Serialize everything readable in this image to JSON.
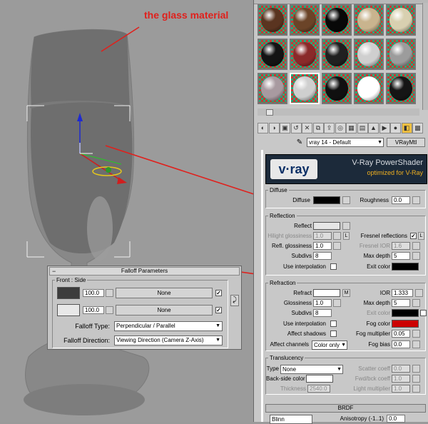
{
  "annotation": {
    "text": "the glass material",
    "color": "#e0201c"
  },
  "material_editor": {
    "slots": [
      {
        "icon": "brown-sphere-icon",
        "color": "#5a3420"
      },
      {
        "icon": "brown-sphere-icon",
        "color": "#6b4428"
      },
      {
        "icon": "black-sphere-icon",
        "color": "#080808"
      },
      {
        "icon": "beige-sphere-icon",
        "color": "#c9b48e"
      },
      {
        "icon": "cream-sphere-icon",
        "color": "#d8d0b0"
      },
      {
        "icon": "glossy-black-sphere-icon",
        "color": "#141414"
      },
      {
        "icon": "checker-sphere-icon",
        "color": "#8a2a2a"
      },
      {
        "icon": "dark-sphere-icon",
        "color": "#202020"
      },
      {
        "icon": "pearl-sphere-icon",
        "color": "#cfcfcf"
      },
      {
        "icon": "gray-sphere-icon",
        "color": "#9c9c9c"
      },
      {
        "icon": "striped-sphere-icon",
        "color": "#a89aa0"
      },
      {
        "icon": "noise-sphere-icon",
        "color": "#cfcfcf"
      },
      {
        "icon": "dark-sphere-icon",
        "color": "#101010"
      },
      {
        "icon": "white-sphere-icon",
        "color": "#ffffff"
      },
      {
        "icon": "dark-sphere-icon",
        "color": "#151515"
      }
    ],
    "toolbar_icons": [
      "get-material-icon",
      "put-material-icon",
      "assign-material-icon",
      "reset-icon",
      "delete-icon",
      "make-unique-icon",
      "put-library-icon",
      "effects-icon",
      "show-map-icon",
      "show-end-icon",
      "go-parent-icon",
      "go-sibling-icon",
      "sample-type-icon",
      "backlight-icon",
      "background-icon"
    ],
    "material_name": "vray 14 - Default",
    "material_type": "VRayMtl",
    "banner": {
      "logo": "v·ray",
      "title": "V-Ray PowerShader",
      "subtitle": "optimized for V-Ray"
    },
    "diffuse": {
      "group": "Diffuse",
      "diffuse_label": "Diffuse",
      "diffuse_color": "#000000",
      "roughness_label": "Roughness",
      "roughness": "0.0"
    },
    "reflection": {
      "group": "Reflection",
      "reflect_label": "Reflect",
      "reflect_color": "#e6e6e6",
      "hilight_label": "Hilight glossiness",
      "hilight": "1.0",
      "l1": "L",
      "fresnel_label": "Fresnel reflections",
      "fresnel_checked": "✓",
      "l2": "L",
      "refl_gloss_label": "Refl. glossiness",
      "refl_gloss": "1.0",
      "fresnel_ior_label": "Fresnel IOR",
      "fresnel_ior": "1.6",
      "subdivs_label": "Subdivs",
      "subdivs": "8",
      "max_depth_label": "Max depth",
      "max_depth": "5",
      "use_interp_label": "Use interpolation",
      "exit_label": "Exit color",
      "exit_color": "#000000"
    },
    "refraction": {
      "group": "Refraction",
      "refract_label": "Refract",
      "refract_color": "#ffffff",
      "map_label": "M",
      "ior_label": "IOR",
      "ior": "1.333",
      "gloss_label": "Glossiness",
      "gloss": "1.0",
      "max_depth_label": "Max depth",
      "max_depth": "5",
      "subdivs_label": "Subdivs",
      "subdivs": "8",
      "exit_label": "Exit color",
      "exit_color": "#000000",
      "use_interp_label": "Use interpolation",
      "fog_color_label": "Fog color",
      "fog_color": "#cc0000",
      "affect_shadows_label": "Affect shadows",
      "fog_mult_label": "Fog multiplier",
      "fog_mult": "0.05",
      "affect_channels_label": "Affect channels",
      "affect_channels": "Color only",
      "fog_bias_label": "Fog bias",
      "fog_bias": "0.0"
    },
    "translucency": {
      "group": "Translucency",
      "type_label": "Type",
      "type": "None",
      "scatter_label": "Scatter coeff",
      "scatter": "0.0",
      "backside_label": "Back-side color",
      "backside_color": "#ffffff",
      "fwd_label": "Fwd/bck coeff",
      "fwd": "1.0",
      "thickness_label": "Thickness",
      "thickness": "2540.0",
      "light_mult_label": "Light multiplier",
      "light_mult": "1.0"
    },
    "brdf": {
      "header": "BRDF",
      "aniso_label": "Anisotropy (-1..1)",
      "aniso": "0.0",
      "type": "Blinn"
    }
  },
  "falloff": {
    "title": "Falloff Parameters",
    "minus": "−",
    "front_side_label": "Front : Side",
    "row1": {
      "color": "#3c3c3c",
      "amount": "100.0",
      "map": "None",
      "checked": "✓"
    },
    "row2": {
      "color": "#e8e8e8",
      "amount": "100.0",
      "map": "None",
      "checked": "✓"
    },
    "swap_icon": "swap-icon",
    "type_label": "Falloff Type:",
    "type_value": "Perpendicular / Parallel",
    "direction_label": "Falloff Direction:",
    "direction_value": "Viewing Direction (Camera Z-Axis)"
  }
}
